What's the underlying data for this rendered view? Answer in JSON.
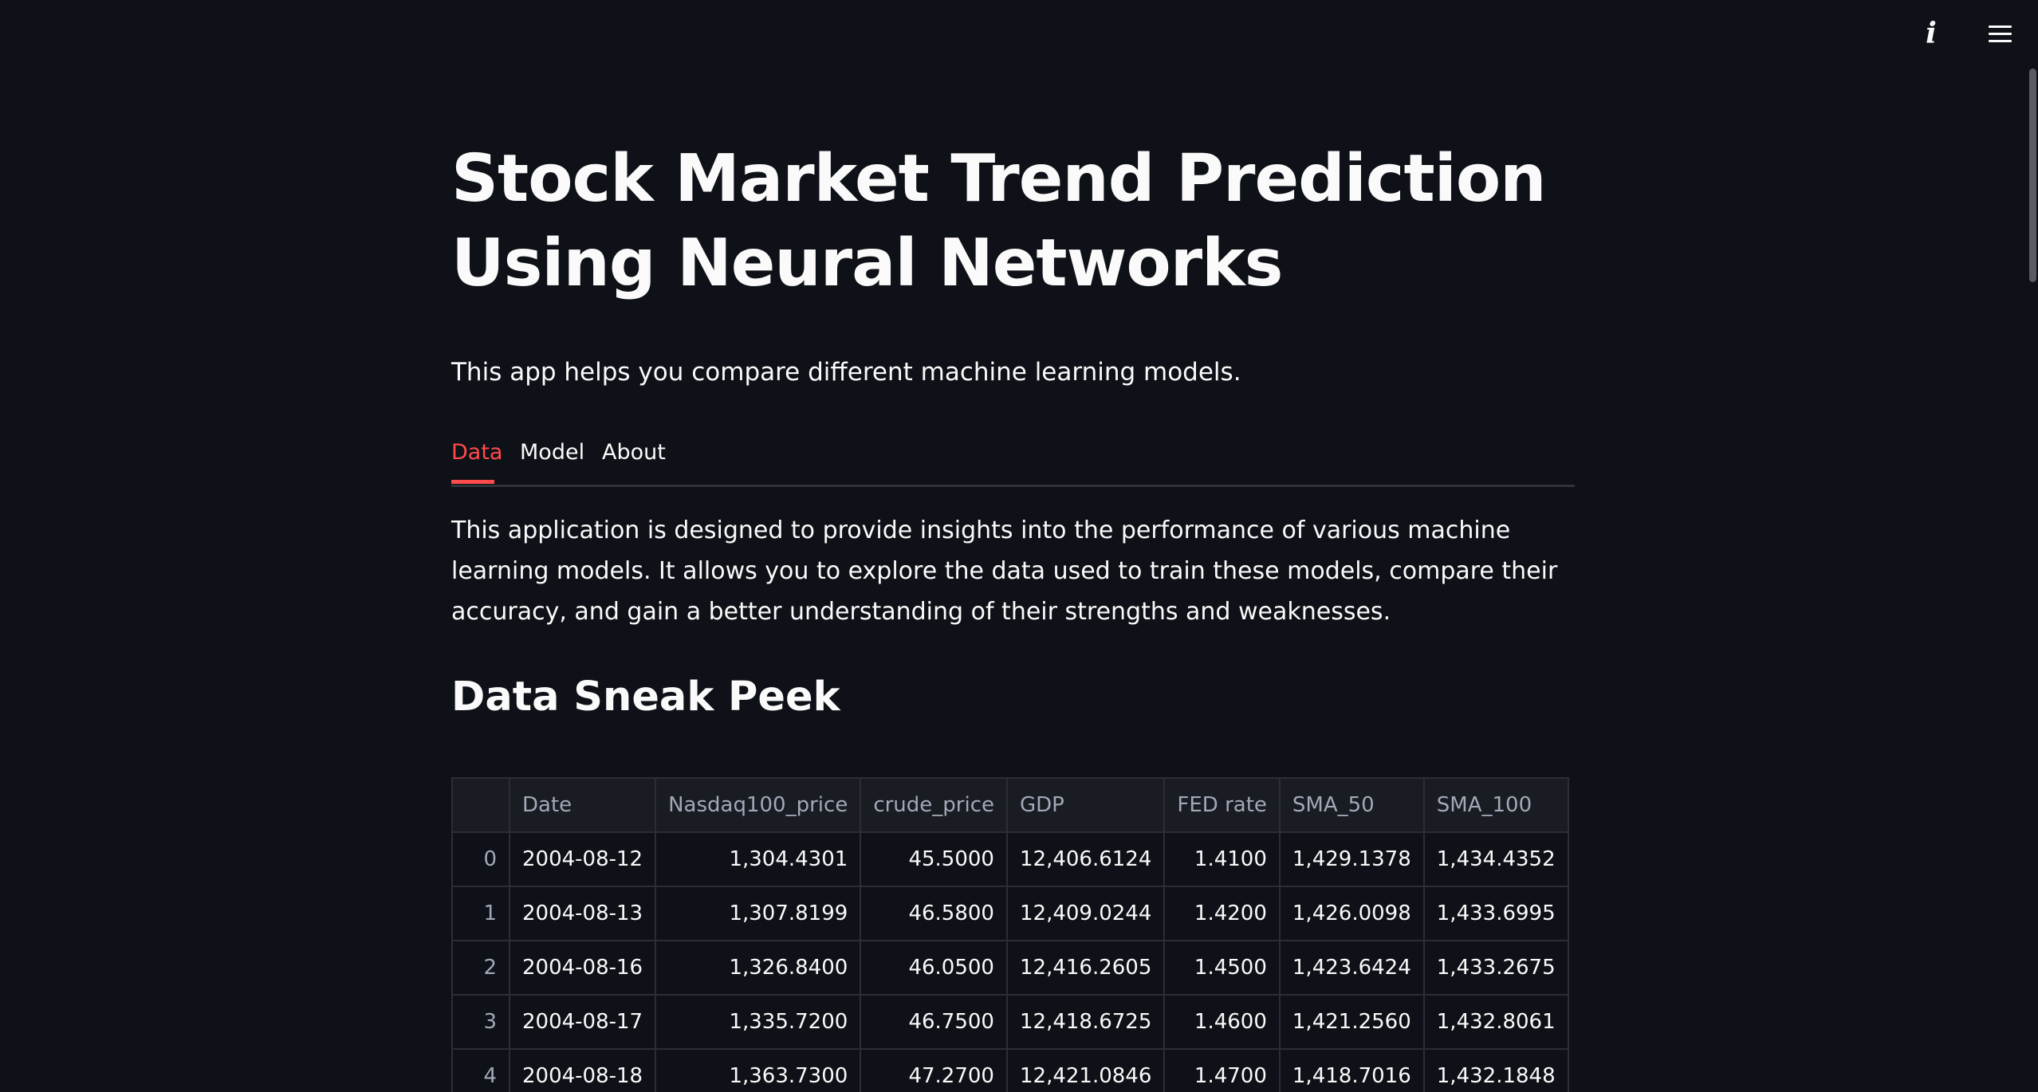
{
  "header": {
    "info_icon": "info-icon",
    "menu_icon": "hamburger-menu-icon",
    "info_glyph": "i"
  },
  "page": {
    "title": "Stock Market Trend Prediction Using Neural Networks",
    "subtitle": "This app helps you compare different machine learning models."
  },
  "tabs": [
    {
      "label": "Data",
      "active": true
    },
    {
      "label": "Model",
      "active": false
    },
    {
      "label": "About",
      "active": false
    }
  ],
  "content": {
    "description": "This application is designed to provide insights into the performance of various machine learning models. It allows you to explore the data used to train these models, compare their accuracy, and gain a better understanding of their strengths and weaknesses.",
    "section_heading": "Data Sneak Peek"
  },
  "table": {
    "columns": [
      "",
      "Date",
      "Nasdaq100_price",
      "crude_price",
      "GDP",
      "FED rate",
      "SMA_50",
      "SMA_100"
    ],
    "rows": [
      [
        "0",
        "2004-08-12",
        "1,304.4301",
        "45.5000",
        "12,406.6124",
        "1.4100",
        "1,429.1378",
        "1,434.4352"
      ],
      [
        "1",
        "2004-08-13",
        "1,307.8199",
        "46.5800",
        "12,409.0244",
        "1.4200",
        "1,426.0098",
        "1,433.6995"
      ],
      [
        "2",
        "2004-08-16",
        "1,326.8400",
        "46.0500",
        "12,416.2605",
        "1.4500",
        "1,423.6424",
        "1,433.2675"
      ],
      [
        "3",
        "2004-08-17",
        "1,335.7200",
        "46.7500",
        "12,418.6725",
        "1.4600",
        "1,421.2560",
        "1,432.8061"
      ],
      [
        "4",
        "2004-08-18",
        "1,363.7300",
        "47.2700",
        "12,421.0846",
        "1.4700",
        "1,418.7016",
        "1,432.1848"
      ]
    ]
  },
  "colors": {
    "background": "#0e1117",
    "text": "#fafafa",
    "accent": "#ff4b4b",
    "muted": "#a3a8b8",
    "border": "#2b2e36"
  }
}
